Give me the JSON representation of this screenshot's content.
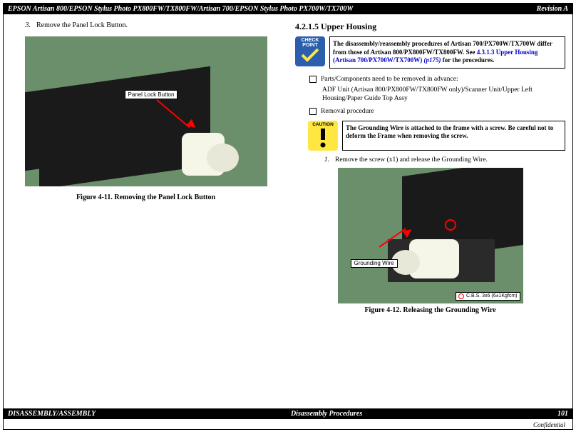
{
  "header": {
    "title": "EPSON Artisan 800/EPSON Stylus Photo PX800FW/TX800FW/Artisan 700/EPSON Stylus Photo PX700W/TX700W",
    "rev": "Revision A"
  },
  "footer": {
    "left": "DISASSEMBLY/ASSEMBLY",
    "center": "Disassembly Procedures",
    "page": "101",
    "conf": "Confidential"
  },
  "left": {
    "step_num": "3.",
    "step_text": "Remove the Panel Lock Button.",
    "callout": "Panel Lock Button",
    "caption": "Figure 4-11.  Removing the Panel Lock Button"
  },
  "right": {
    "section": "4.2.1.5  Upper Housing",
    "check_label1": "CHECK",
    "check_label2": "POINT",
    "check_text1": "The disassembly/reassembly procedures of Artisan 700/PX700W/TX700W differ from those of Artisan 800/PX800FW/TX800FW. See ",
    "check_link": "4.3.1.3  Upper Housing (Artisan 700/PX700W/TX700W)",
    "check_link_suffix": " (p175)",
    "check_text2": " for the procedures.",
    "pre_label": "Parts/Components need to be removed in advance:",
    "pre_text": "ADF Unit (Artisan 800/PX800FW/TX800FW only)/Scanner Unit/Upper Left Housing/Paper Guide Top Assy",
    "proc_label": "Removal procedure",
    "caution_label": "CAUTION",
    "caution_text": "The Grounding Wire is attached to the frame with a screw. Be careful not to deform the Frame when removing the screw.",
    "step1_num": "1.",
    "step1_text": "Remove the screw (x1) and release the Grounding Wire.",
    "callout2": "Grounding Wire",
    "cbs": "C.B.S. 3x6 (6±1Kgfcm)",
    "caption2": "Figure 4-12.  Releasing the Grounding Wire"
  }
}
